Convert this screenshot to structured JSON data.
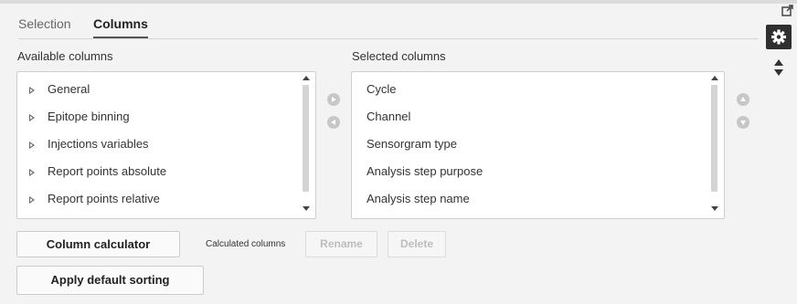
{
  "tabs": [
    {
      "label": "Selection",
      "active": false
    },
    {
      "label": "Columns",
      "active": true
    }
  ],
  "available": {
    "label": "Available columns",
    "items": [
      "General",
      "Epitope binning",
      "Injections variables",
      "Report points absolute",
      "Report points relative"
    ]
  },
  "selected": {
    "label": "Selected columns",
    "items": [
      "Cycle",
      "Channel",
      "Sensorgram type",
      "Analysis step purpose",
      "Analysis step name"
    ]
  },
  "buttons": {
    "column_calculator": "Column calculator",
    "calculated_columns_label": "Calculated columns",
    "rename": "Rename",
    "delete": "Delete",
    "apply_default_sorting": "Apply default sorting"
  },
  "icons": {
    "open_external": "external-link-icon",
    "settings": "gear-icon",
    "sort": "sort-icon",
    "move_right": "arrow-right-circle-icon",
    "move_left": "arrow-left-circle-icon",
    "move_up": "arrow-up-circle-icon",
    "move_down": "arrow-down-circle-icon"
  },
  "colors": {
    "background": "#f3f3f3",
    "gear_box": "#2f2f2f",
    "disabled_text": "#bdbdbd"
  }
}
